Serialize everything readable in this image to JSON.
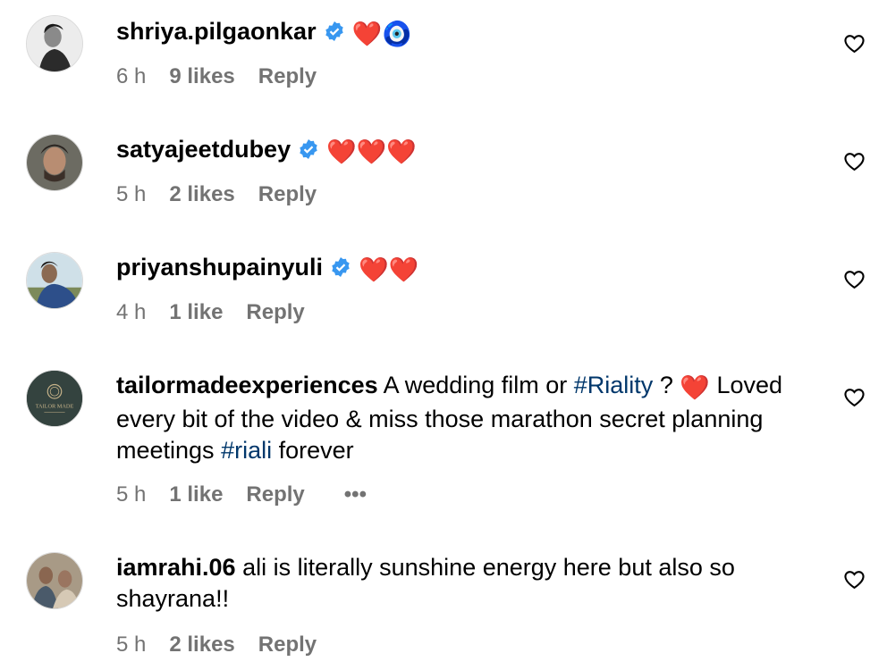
{
  "comments": [
    {
      "username": "shriya.pilgaonkar",
      "verified": true,
      "text": "",
      "emoji": "❤️🧿",
      "time": "6 h",
      "likes": "9 likes",
      "reply": "Reply"
    },
    {
      "username": "satyajeetdubey",
      "verified": true,
      "text": "",
      "emoji": "❤️❤️❤️",
      "time": "5 h",
      "likes": "2 likes",
      "reply": "Reply"
    },
    {
      "username": "priyanshupainyuli",
      "verified": true,
      "text": "",
      "emoji": "❤️❤️",
      "time": "4 h",
      "likes": "1 like",
      "reply": "Reply"
    },
    {
      "username": "tailormadeexperiences",
      "verified": false,
      "text_parts": [
        "A wedding film or ",
        "#Riality",
        " ? ",
        "Loved every bit of the video & miss those marathon secret planning meetings ",
        "#riali",
        " forever"
      ],
      "emoji": "❤️",
      "time": "5 h",
      "likes": "1 like",
      "reply": "Reply",
      "more": "•••",
      "avatar_text": "TAILOR MADE"
    },
    {
      "username": "iamrahi.06",
      "verified": false,
      "text": "ali is literally sunshine energy here but also so shayrana!!",
      "time": "5 h",
      "likes": "2 likes",
      "reply": "Reply"
    }
  ],
  "colors": {
    "verified": "#3897f0",
    "hashtag": "#00376b",
    "meta": "#737373",
    "heart": "#e0245e"
  }
}
